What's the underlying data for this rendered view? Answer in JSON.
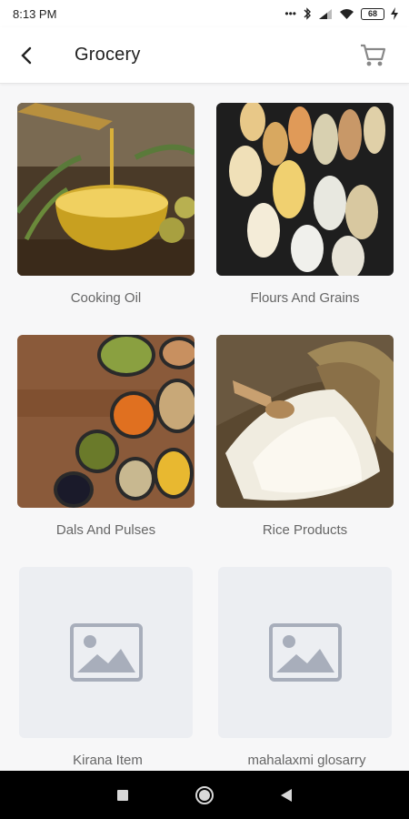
{
  "status": {
    "time": "8:13 PM",
    "battery": "68"
  },
  "header": {
    "title": "Grocery"
  },
  "categories": [
    {
      "label": "Cooking Oil"
    },
    {
      "label": "Flours And Grains"
    },
    {
      "label": "Dals And Pulses"
    },
    {
      "label": "Rice Products"
    },
    {
      "label": "Kirana Item"
    },
    {
      "label": "mahalaxmi glosarry"
    }
  ],
  "colors": {
    "primary_text": "#222222",
    "label_text": "#666666",
    "background": "#f7f7f8",
    "nav_bar": "#000000"
  }
}
